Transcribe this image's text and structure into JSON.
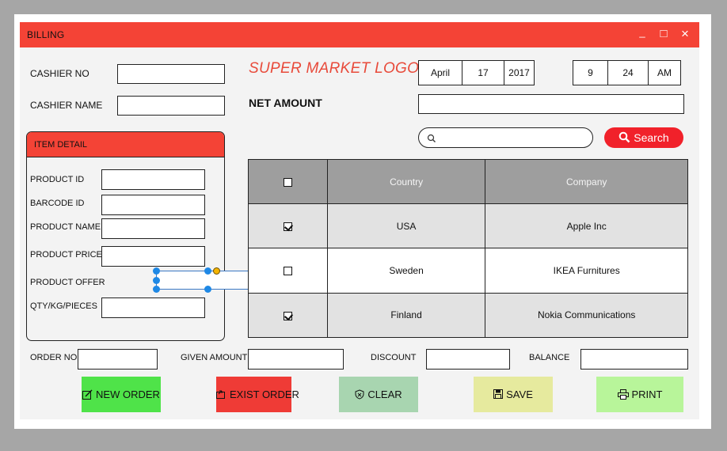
{
  "window": {
    "title": "BILLING",
    "minimize": "_",
    "maximize": "□",
    "close": "×"
  },
  "cashier": {
    "no_label": "CASHIER NO",
    "name_label": "CASHIER NAME",
    "no_value": "",
    "name_value": ""
  },
  "logo": "SUPER MARKET LOGO",
  "net_amount_label": "NET AMOUNT",
  "date": {
    "month": "April",
    "day": "17",
    "year": "2017"
  },
  "time": {
    "hour": "9",
    "minute": "24",
    "ampm": "AM"
  },
  "search": {
    "placeholder": "",
    "button_label": "Search"
  },
  "item_detail": {
    "title": "ITEM DETAIL",
    "fields": [
      {
        "label": "PRODUCT ID",
        "value": ""
      },
      {
        "label": "BARCODE ID",
        "value": ""
      },
      {
        "label": "PRODUCT NAME",
        "value": ""
      },
      {
        "label": "PRODUCT PRICE",
        "value": ""
      },
      {
        "label": "PRODUCT OFFER",
        "value": ""
      },
      {
        "label": "QTY/KG/PIECES",
        "value": ""
      }
    ]
  },
  "table": {
    "headers": [
      "",
      "Country",
      "Company"
    ],
    "header_checked": false,
    "rows": [
      {
        "checked": true,
        "country": "USA",
        "company": "Apple Inc"
      },
      {
        "checked": false,
        "country": "Sweden",
        "company": "IKEA Furnitures"
      },
      {
        "checked": true,
        "country": "Finland",
        "company": "Nokia Communications"
      }
    ]
  },
  "footer": {
    "order_no_label": "ORDER NO",
    "given_amount_label": "GIVEN AMOUNT",
    "discount_label": "DISCOUNT",
    "balance_label": "BALANCE"
  },
  "buttons": {
    "new_order": {
      "label": "NEW ORDER",
      "icon": "edit-icon",
      "color": "#4fe349"
    },
    "exist_order": {
      "label": "EXIST ORDER",
      "icon": "exit-icon",
      "color": "#ef3b36"
    },
    "clear": {
      "label": "CLEAR",
      "icon": "shield-icon",
      "color": "#a8d5b0"
    },
    "save": {
      "label": "SAVE",
      "icon": "floppy-icon",
      "color": "#e6ea9e"
    },
    "print": {
      "label": "PRINT",
      "icon": "printer-icon",
      "color": "#b8f59a"
    }
  },
  "colors": {
    "accent": "#f44336",
    "search_button": "#f1212a",
    "table_header": "#9e9e9e",
    "logo": "#e84a3a"
  }
}
